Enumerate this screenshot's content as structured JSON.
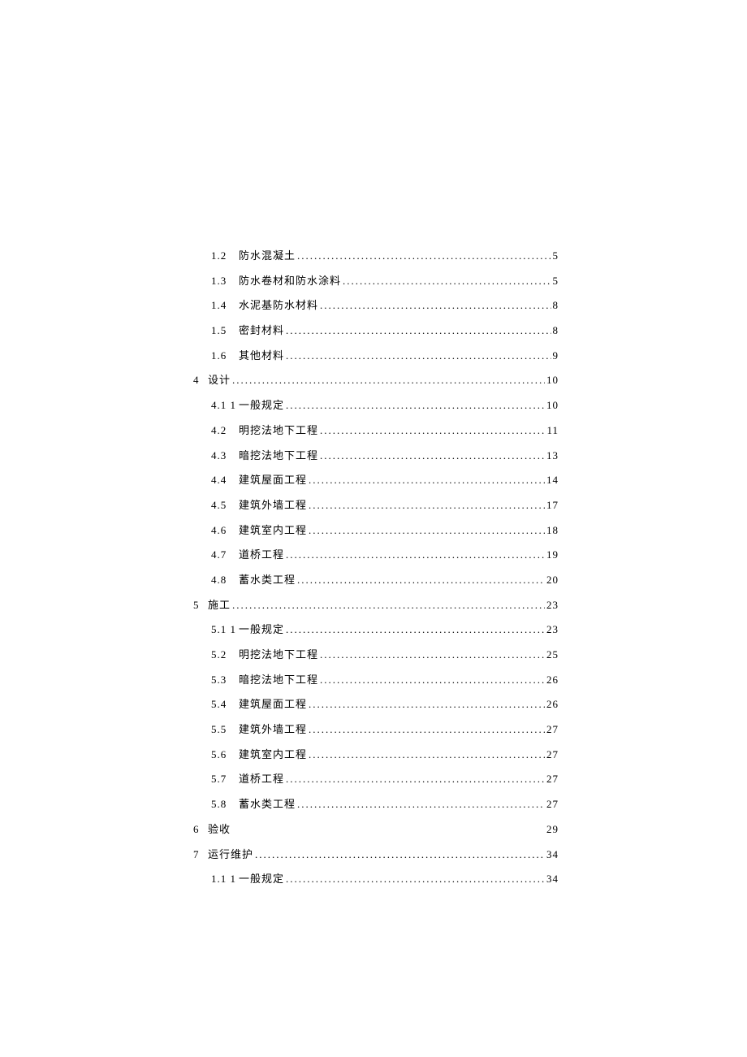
{
  "entries": [
    {
      "level": "section",
      "num": "1.2",
      "title": "防水混凝土",
      "page": "5",
      "noDots": false
    },
    {
      "level": "section",
      "num": "1.3",
      "title": "防水卷材和防水涂料",
      "page": "5",
      "noDots": false
    },
    {
      "level": "section",
      "num": "1.4",
      "title": "水泥基防水材料",
      "page": "8",
      "noDots": false
    },
    {
      "level": "section",
      "num": "1.5",
      "title": "密封材料",
      "page": "8",
      "noDots": false
    },
    {
      "level": "section",
      "num": "1.6",
      "title": "其他材料",
      "page": "9",
      "noDots": false
    },
    {
      "level": "chapter",
      "num": "4",
      "title": "设计",
      "page": "10",
      "noDots": false
    },
    {
      "level": "section",
      "num": "4.1 1",
      "title": "一般规定",
      "page": "10",
      "noDots": false
    },
    {
      "level": "section",
      "num": "4.2",
      "title": "明挖法地下工程",
      "page": "11",
      "noDots": false
    },
    {
      "level": "section",
      "num": "4.3",
      "title": "暗挖法地下工程",
      "page": "13",
      "noDots": false
    },
    {
      "level": "section",
      "num": "4.4",
      "title": "建筑屋面工程",
      "page": "14",
      "noDots": false
    },
    {
      "level": "section",
      "num": "4.5",
      "title": "建筑外墙工程",
      "page": "17",
      "noDots": false
    },
    {
      "level": "section",
      "num": "4.6",
      "title": "建筑室内工程",
      "page": "18",
      "noDots": false
    },
    {
      "level": "section",
      "num": "4.7",
      "title": "道桥工程",
      "page": "19",
      "noDots": false
    },
    {
      "level": "section",
      "num": "4.8",
      "title": "蓄水类工程",
      "page": "20",
      "noDots": false
    },
    {
      "level": "chapter",
      "num": "5",
      "title": "施工",
      "page": "23",
      "noDots": false
    },
    {
      "level": "section",
      "num": "5.1 1",
      "title": "一般规定",
      "page": "23",
      "noDots": false
    },
    {
      "level": "section",
      "num": "5.2",
      "title": "明挖法地下工程",
      "page": "25",
      "noDots": false
    },
    {
      "level": "section",
      "num": "5.3",
      "title": "暗挖法地下工程",
      "page": "26",
      "noDots": false
    },
    {
      "level": "section",
      "num": "5.4",
      "title": "建筑屋面工程",
      "page": "26",
      "noDots": false
    },
    {
      "level": "section",
      "num": "5.5",
      "title": "建筑外墙工程",
      "page": "27",
      "noDots": false
    },
    {
      "level": "section",
      "num": "5.6",
      "title": "建筑室内工程",
      "page": "27",
      "noDots": false
    },
    {
      "level": "section",
      "num": "5.7",
      "title": "道桥工程",
      "page": "27",
      "noDots": false
    },
    {
      "level": "section",
      "num": "5.8",
      "title": "蓄水类工程",
      "page": "27",
      "noDots": false
    },
    {
      "level": "chapter",
      "num": "6",
      "title": "验收",
      "page": "29",
      "noDots": true
    },
    {
      "level": "chapter",
      "num": "7",
      "title": "运行维护",
      "page": "34",
      "noDots": false
    },
    {
      "level": "section",
      "num": "1.1 1",
      "title": "一般规定",
      "page": "34",
      "noDots": false
    }
  ]
}
